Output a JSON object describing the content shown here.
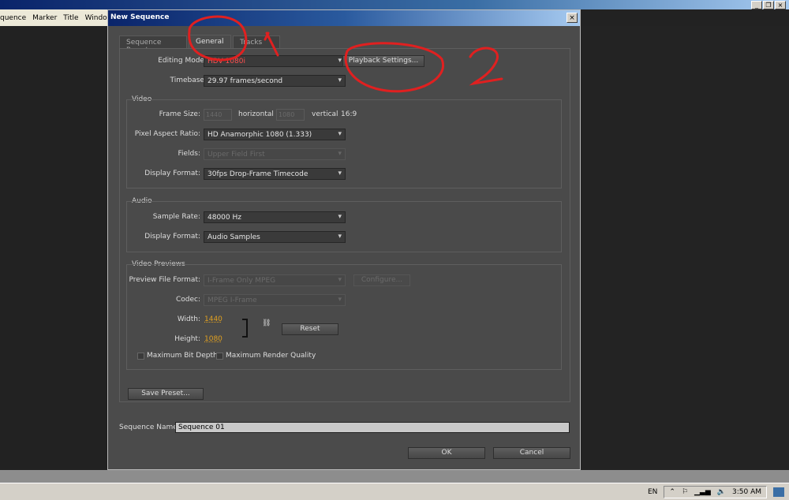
{
  "menubar": {
    "items": [
      "quence",
      "Marker",
      "Title",
      "Window"
    ]
  },
  "dialog": {
    "title": "New Sequence",
    "tabs": [
      "Sequence Presets",
      "General",
      "Tracks"
    ],
    "editing_mode": {
      "label": "Editing Mode:",
      "value": "HDV 1080i"
    },
    "playback_settings": "Playback Settings...",
    "timebase": {
      "label": "Timebase:",
      "value": "29.97 frames/second"
    },
    "video": {
      "title": "Video",
      "frame_size_label": "Frame Size:",
      "frame_width": "1440",
      "horizontal": "horizontal",
      "frame_height": "1080",
      "vertical": "vertical",
      "aspect": "16:9",
      "par": {
        "label": "Pixel Aspect Ratio:",
        "value": "HD Anamorphic 1080 (1.333)"
      },
      "fields": {
        "label": "Fields:",
        "value": "Upper Field First"
      },
      "display_format": {
        "label": "Display Format:",
        "value": "30fps Drop-Frame Timecode"
      }
    },
    "audio": {
      "title": "Audio",
      "sample_rate": {
        "label": "Sample Rate:",
        "value": "48000 Hz"
      },
      "display_format": {
        "label": "Display Format:",
        "value": "Audio Samples"
      }
    },
    "previews": {
      "title": "Video Previews",
      "file_format": {
        "label": "Preview File Format:",
        "value": "I-Frame Only MPEG"
      },
      "configure": "Configure...",
      "codec": {
        "label": "Codec:",
        "value": "MPEG I-Frame"
      },
      "width": {
        "label": "Width:",
        "value": "1440"
      },
      "height": {
        "label": "Height:",
        "value": "1080"
      },
      "reset": "Reset",
      "max_bit_depth": "Maximum Bit Depth",
      "max_render_quality": "Maximum Render Quality"
    },
    "save_preset": "Save Preset...",
    "sequence_name": {
      "label": "Sequence Name:",
      "value": "Sequence 01"
    },
    "ok": "OK",
    "cancel": "Cancel"
  },
  "annotations": [
    "1",
    "2"
  ],
  "tray": {
    "lang": "EN",
    "time": "3:50 AM"
  },
  "colors": {
    "annotation": "#e02020",
    "editing_mode_value": "#ff5050",
    "link_value": "#e0a020"
  }
}
